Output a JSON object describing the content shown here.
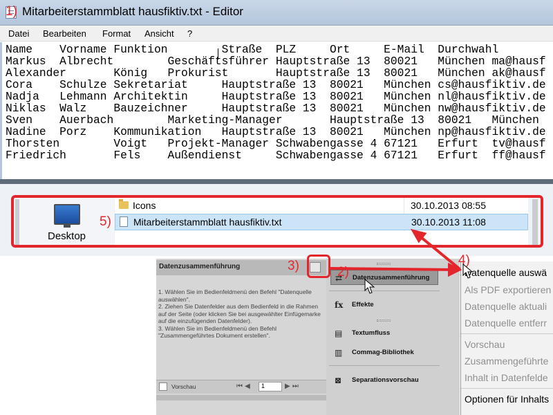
{
  "notepad": {
    "title": "Mitarbeiterstammblatt hausfiktiv.txt - Editor",
    "menu": [
      "Datei",
      "Bearbeiten",
      "Format",
      "Ansicht",
      "?"
    ],
    "lines": [
      "Name    Vorname Funktion        Straße  PLZ     Ort     E-Mail  Durchwahl",
      "Markus  Albrecht        Geschäftsführer Hauptstraße 13  80021   München ma@hausf",
      "Alexander       König   Prokurist       Hauptstraße 13  80021   München ak@hausf",
      "Cora    Schulze Sekretariat     Hauptstraße 13  80021   München cs@hausfiktiv.de",
      "Nadja   Lehmann Architektin     Hauptstraße 13  80021   München nl@hausfiktiv.de",
      "Niklas  Walz    Bauzeichner     Hauptstraße 13  80021   München nw@hausfiktiv.de",
      "Sven    Auerbach        Marketing-Manager       Hauptstraße 13  80021   München",
      "Nadine  Porz    Kommunikation   Hauptstraße 13  80021   München np@hausfiktiv.de",
      "Thorsten        Voigt   Projekt-Manager Schwabengasse 4 67121   Erfurt  tv@hausf",
      "Friedrich       Fels    Außendienst     Schwabengasse 4 67121   Erfurt  ff@hausf"
    ]
  },
  "explorer": {
    "nav_label": "Desktop",
    "files": [
      {
        "name": "Icons",
        "date": "30.10.2013 08:55",
        "type": "folder",
        "selected": false
      },
      {
        "name": "Mitarbeiterstammblatt hausfiktiv.txt",
        "date": "30.10.2013 11:08",
        "type": "file",
        "selected": true
      }
    ]
  },
  "indesign": {
    "panel_title": "Datenzusammenführung",
    "help_text": "1. Wählen Sie im Bedienfeldmenü den Befehl \"Datenquelle auswählen\".\n2. Ziehen Sie Datenfelder aus dem Bedienfeld in die Rahmen auf der Seite (oder klicken Sie bei ausgewählter Einfügemarke auf die einzufügenden Datenfelder).\n3. Wählen Sie im Bedienfeldmenü den Befehl \"Zusammengeführtes Dokument erstellen\".",
    "preview_label": "Vorschau",
    "record_value": "1",
    "dock": [
      {
        "label": "Datenzusammenführung",
        "icon": "merge-icon",
        "active": true
      },
      {
        "label": "Effekte",
        "icon": "fx-icon",
        "active": false
      },
      {
        "label": "Textumfluss",
        "icon": "textwrap-icon",
        "active": false
      },
      {
        "label": "Commag-Bibliothek",
        "icon": "library-icon",
        "active": false
      },
      {
        "label": "Separationsvorschau",
        "icon": "separations-icon",
        "active": false
      }
    ],
    "context_menu": [
      {
        "label": "Datenquelle auswä",
        "enabled": true
      },
      {
        "label": "Als PDF exportieren",
        "enabled": false
      },
      {
        "label": "Datenquelle aktuali",
        "enabled": false
      },
      {
        "label": "Datenquelle entferr",
        "enabled": false
      },
      {
        "label": "Vorschau",
        "enabled": false
      },
      {
        "label": "Zusammengeführte",
        "enabled": false
      },
      {
        "label": "Inhalt in Datenfelde",
        "enabled": false
      },
      {
        "label": "Optionen für Inhalts",
        "enabled": true
      }
    ]
  },
  "annotations": {
    "step1": "1)",
    "step2": "2)",
    "step3": "3)",
    "step4": "4)",
    "step5": "5)",
    "color": "#e3262b"
  }
}
